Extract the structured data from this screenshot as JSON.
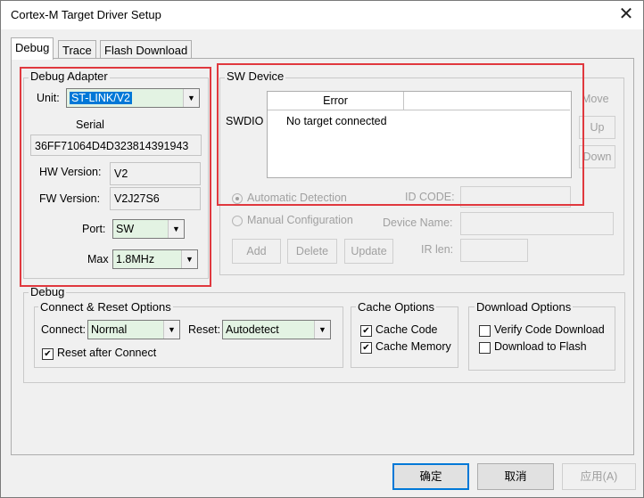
{
  "window": {
    "title": "Cortex-M Target Driver Setup",
    "close_icon": "close-icon"
  },
  "tabs": [
    {
      "label": "Debug",
      "active": true
    },
    {
      "label": "Trace",
      "active": false
    },
    {
      "label": "Flash Download",
      "active": false
    }
  ],
  "debug_adapter": {
    "group_label": "Debug Adapter",
    "unit_label": "Unit:",
    "unit_value": "ST-LINK/V2",
    "serial_label": "Serial",
    "serial_value": "36FF71064D4D323814391943",
    "hw_label": "HW Version:",
    "hw_value": "V2",
    "fw_label": "FW Version:",
    "fw_value": "V2J27S6",
    "port_label": "Port:",
    "port_value": "SW",
    "max_label": "Max",
    "max_value": "1.8MHz"
  },
  "sw_device": {
    "group_label": "SW Device",
    "column_header": "Error",
    "row_label": "SWDIO",
    "row_text": "No target connected",
    "move_label": "Move",
    "up_label": "Up",
    "down_label": "Down",
    "auto_detect_label": "Automatic Detection",
    "manual_config_label": "Manual Configuration",
    "id_code_label": "ID CODE:",
    "device_name_label": "Device Name:",
    "ir_len_label": "IR len:",
    "add_label": "Add",
    "delete_label": "Delete",
    "update_label": "Update"
  },
  "debug": {
    "group_label": "Debug",
    "connect_reset": {
      "group_label": "Connect & Reset Options",
      "connect_label": "Connect:",
      "connect_value": "Normal",
      "reset_label": "Reset:",
      "reset_value": "Autodetect",
      "reset_after_connect_label": "Reset after Connect",
      "reset_after_connect_checked": true
    },
    "cache": {
      "group_label": "Cache Options",
      "cache_code_label": "Cache Code",
      "cache_code_checked": true,
      "cache_memory_label": "Cache Memory",
      "cache_memory_checked": true
    },
    "download": {
      "group_label": "Download Options",
      "verify_label": "Verify Code Download",
      "verify_checked": false,
      "flash_label": "Download to Flash",
      "flash_checked": false
    }
  },
  "footer": {
    "ok_label": "确定",
    "cancel_label": "取消",
    "apply_label": "应用(A)"
  },
  "colors": {
    "highlight_box": "#e0383e",
    "combo_bg": "#e3f3e3",
    "selection": "#0078d7"
  }
}
